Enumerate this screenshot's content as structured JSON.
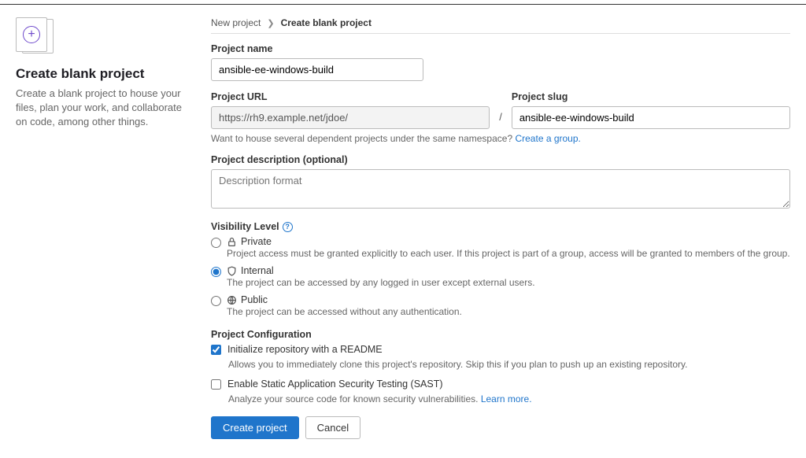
{
  "breadcrumb": {
    "parent": "New project",
    "current": "Create blank project"
  },
  "sidebar": {
    "title": "Create blank project",
    "description": "Create a blank project to house your files, plan your work, and collaborate on code, among other things."
  },
  "form": {
    "name_label": "Project name",
    "name_value": "ansible-ee-windows-build",
    "url_label": "Project URL",
    "url_value": "https://rh9.example.net/jdoe/",
    "slash": "/",
    "slug_label": "Project slug",
    "slug_value": "ansible-ee-windows-build",
    "namespace_hint": "Want to house several dependent projects under the same namespace? ",
    "namespace_link": "Create a group.",
    "desc_label": "Project description (optional)",
    "desc_placeholder": "Description format"
  },
  "visibility": {
    "label": "Visibility Level",
    "options": [
      {
        "title": "Private",
        "desc": "Project access must be granted explicitly to each user. If this project is part of a group, access will be granted to members of the group."
      },
      {
        "title": "Internal",
        "desc": "The project can be accessed by any logged in user except external users."
      },
      {
        "title": "Public",
        "desc": "The project can be accessed without any authentication."
      }
    ],
    "selected": "Internal"
  },
  "config": {
    "label": "Project Configuration",
    "readme_label": "Initialize repository with a README",
    "readme_desc": "Allows you to immediately clone this project's repository. Skip this if you plan to push up an existing repository.",
    "readme_checked": true,
    "sast_label": "Enable Static Application Security Testing (SAST)",
    "sast_desc_pre": "Analyze your source code for known security vulnerabilities. ",
    "sast_link": "Learn more.",
    "sast_checked": false
  },
  "buttons": {
    "create": "Create project",
    "cancel": "Cancel"
  }
}
